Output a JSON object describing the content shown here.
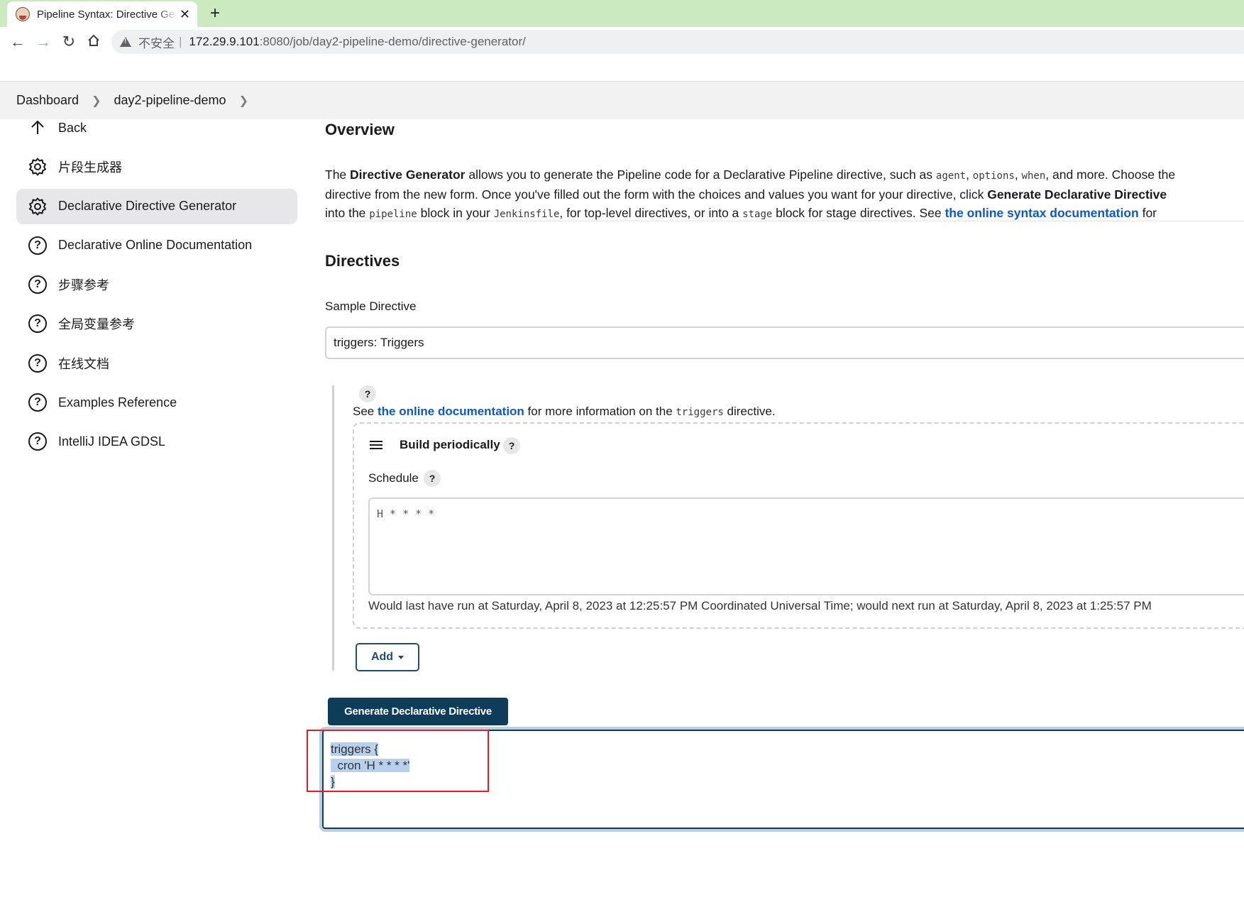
{
  "browser": {
    "tab_title": "Pipeline Syntax: Directive Generator",
    "address": {
      "insecure_label": "不安全",
      "separator": "|",
      "host": "172.29.9.101",
      "path": ":8080/job/day2-pipeline-demo/directive-generator/"
    }
  },
  "breadcrumbs": [
    "Dashboard",
    "day2-pipeline-demo"
  ],
  "sidebar": {
    "items": [
      {
        "label": "Back"
      },
      {
        "label": "片段生成器"
      },
      {
        "label": "Declarative Directive Generator"
      },
      {
        "label": "Declarative Online Documentation"
      },
      {
        "label": "步骤参考"
      },
      {
        "label": "全局变量参考"
      },
      {
        "label": "在线文档"
      },
      {
        "label": "Examples Reference"
      },
      {
        "label": "IntelliJ IDEA GDSL"
      }
    ]
  },
  "overview": {
    "heading": "Overview",
    "line1": {
      "t1": "The ",
      "b1": "Directive Generator",
      "t2": " allows you to generate the Pipeline code for a Declarative Pipeline directive, such as ",
      "c1": "agent",
      "t3": ", ",
      "c2": "options",
      "t4": ", ",
      "c3": "when",
      "t5": ", and more. Choose the"
    },
    "line2": {
      "t1": "directive from the new form. Once you've filled out the form with the choices and values you want for your directive, click ",
      "b1": "Generate Declarative Directive"
    },
    "line3": {
      "t1": "into the ",
      "c1": "pipeline",
      "t2": " block in your ",
      "c2": "Jenkinsfile",
      "t3": ", for top-level directives, or into a ",
      "c3": "stage",
      "t4": " block for stage directives. See ",
      "link": "the online syntax documentation",
      "t5": " for"
    }
  },
  "directives": {
    "heading": "Directives",
    "sample_label": "Sample Directive",
    "sample_value": "triggers: Triggers",
    "help_q": "?",
    "see_line": {
      "t1": "See ",
      "link": "the online documentation",
      "t2": " for more information on the ",
      "code": "triggers",
      "t3": " directive."
    },
    "trigger_block": {
      "title": "Build periodically",
      "schedule_label": "Schedule",
      "schedule_value": "H * * * *",
      "run_info": "Would last have run at Saturday, April 8, 2023 at 12:25:57 PM Coordinated Universal Time; would next run at Saturday, April 8, 2023 at 1:25:57 PM"
    },
    "add_label": "Add",
    "generate_label": "Generate Declarative Directive",
    "output_lines": [
      "triggers {",
      "  cron 'H * * * *'",
      "}"
    ]
  }
}
